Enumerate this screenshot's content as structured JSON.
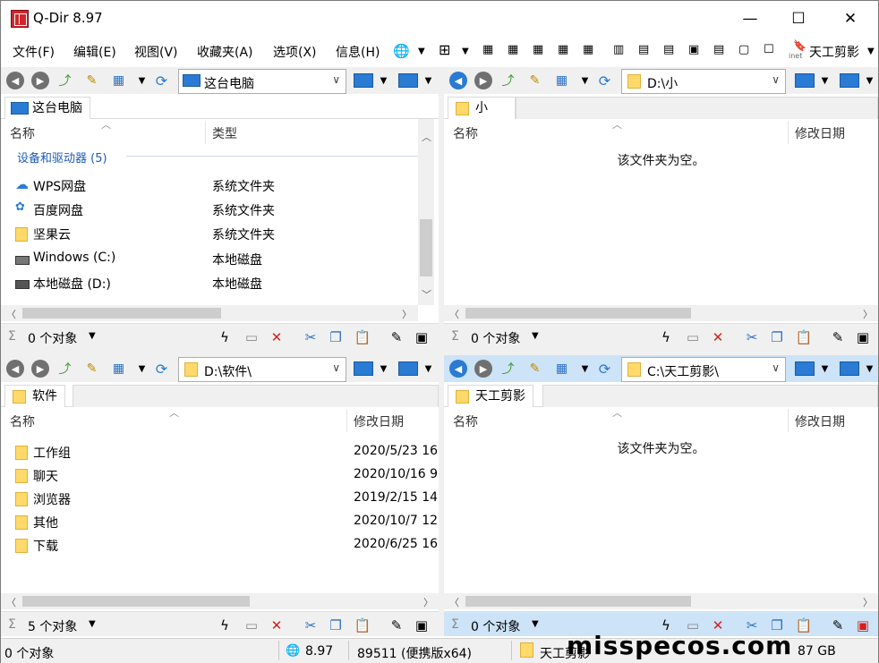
{
  "window": {
    "title": "Q-Dir 8.97",
    "minimize": "—",
    "maximize": "☐",
    "close": "✕"
  },
  "menu": [
    "文件(F)",
    "编辑(E)",
    "视图(V)",
    "收藏夹(A)",
    "选项(X)",
    "信息(H)"
  ],
  "menu_right": {
    "label": "天工剪影",
    "sub": "inet"
  },
  "panes": [
    {
      "address": "这台电脑",
      "tab": "这台电脑",
      "columns": [
        "名称",
        "类型"
      ],
      "group": "设备和驱动器 (5)",
      "rows": [
        {
          "name": "WPS网盘",
          "type": "系统文件夹",
          "icon": "cloud-icon"
        },
        {
          "name": "百度网盘",
          "type": "系统文件夹",
          "icon": "baidu-icon"
        },
        {
          "name": "坚果云",
          "type": "系统文件夹",
          "icon": "folder-icon"
        },
        {
          "name": "Windows (C:)",
          "type": "本地磁盘",
          "icon": "drive-icon"
        },
        {
          "name": "本地磁盘 (D:)",
          "type": "本地磁盘",
          "icon": "drive-icon"
        }
      ],
      "status": "0 个对象"
    },
    {
      "address": "D:\\小",
      "tab": "小",
      "columns": [
        "名称",
        "修改日期"
      ],
      "empty_text": "该文件夹为空。",
      "status": "0 个对象"
    },
    {
      "address": "D:\\软件\\",
      "tab": "软件",
      "columns": [
        "名称",
        "修改日期"
      ],
      "rows": [
        {
          "name": "工作组",
          "date": "2020/5/23 16"
        },
        {
          "name": "聊天",
          "date": "2020/10/16 9"
        },
        {
          "name": "浏览器",
          "date": "2019/2/15 14"
        },
        {
          "name": "其他",
          "date": "2020/10/7 12"
        },
        {
          "name": "下载",
          "date": "2020/6/25 16"
        }
      ],
      "status": "5 个对象"
    },
    {
      "address": "C:\\天工剪影\\",
      "tab": "天工剪影",
      "columns": [
        "名称",
        "修改日期"
      ],
      "empty_text": "该文件夹为空。",
      "status": "0 个对象"
    }
  ],
  "statusbar": {
    "objects": "0 个对象",
    "version": "8.97",
    "build": "89511 (便携版x64)",
    "folder": "天工剪影",
    "size": "87 GB"
  },
  "watermark": "misspecos.com"
}
